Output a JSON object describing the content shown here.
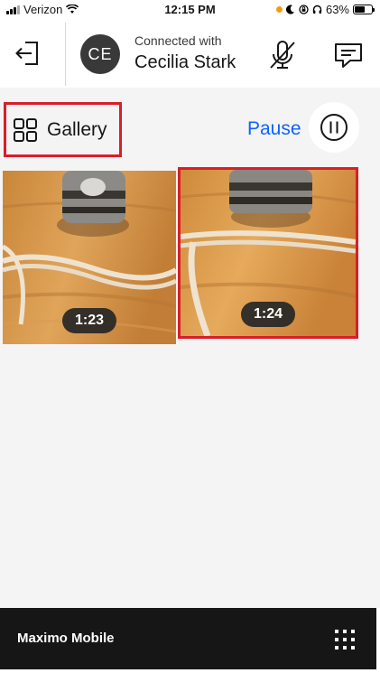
{
  "status_bar": {
    "carrier": "Verizon",
    "time": "12:15 PM",
    "battery": "63%",
    "battery_level": 0.63
  },
  "header": {
    "avatar_initials": "CE",
    "connected_label": "Connected with",
    "user_name": "Cecilia Stark"
  },
  "toolbar": {
    "gallery_label": "Gallery",
    "pause_label": "Pause"
  },
  "gallery": {
    "items": [
      {
        "duration": "1:23",
        "selected": false
      },
      {
        "duration": "1:24",
        "selected": true
      }
    ]
  },
  "footer": {
    "app_name": "Maximo Mobile"
  },
  "icons": {
    "exit": "exit-icon",
    "mic_muted": "mic-off-icon",
    "chat": "chat-icon",
    "gallery": "grid-icon",
    "pause": "pause-icon",
    "app_switcher": "app-switcher-icon"
  },
  "colors": {
    "accent_blue": "#0f62fe",
    "highlight_red": "#da1e28",
    "footer_bg": "#161616",
    "avatar_bg": "#393939"
  }
}
